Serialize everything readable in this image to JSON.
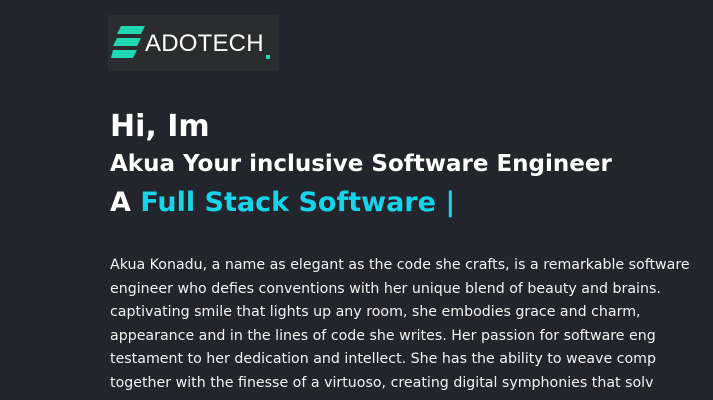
{
  "brand": {
    "logo_text": "ADOTECH",
    "colors": {
      "mark": "#1fd8b2",
      "background": "#2a2c2f"
    }
  },
  "hero": {
    "greeting": "Hi, Im",
    "tagline": "Akua Your inclusive Software Engineer",
    "role_prefix": "A",
    "role_highlight": "Full Stack Software |",
    "accent_color": "#17d4ea"
  },
  "about": {
    "lines": [
      "Akua Konadu, a name as elegant as the code she crafts, is a remarkable software",
      "engineer who defies conventions with her unique blend of beauty and brains.",
      "captivating smile that lights up any room, she embodies grace and charm,",
      "appearance and in the lines of code she writes. Her passion for software eng",
      "testament to her dedication and intellect. She has the ability to weave comp",
      "together with the finesse of a virtuoso, creating digital symphonies that solv"
    ]
  },
  "theme": {
    "page_background": "#22252b",
    "text_color": "#ffffff"
  }
}
